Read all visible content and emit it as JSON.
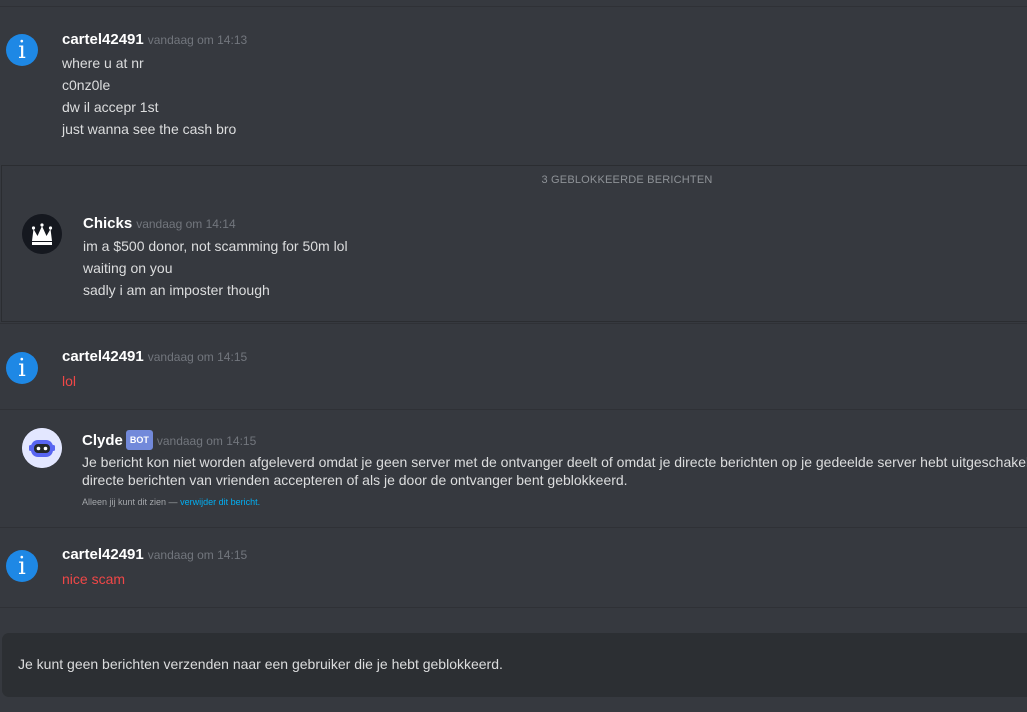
{
  "messages": [
    {
      "username": "cartel42491",
      "timestamp": "vandaag om 14:13",
      "avatar_icon": "info-icon",
      "lines": [
        "where u at nr",
        "c0nz0le",
        "dw il accepr 1st",
        "just wanna see the cash bro"
      ]
    },
    {
      "username": "cartel42491",
      "timestamp": "vandaag om 14:15",
      "avatar_icon": "info-icon",
      "lines": [
        "lol"
      ]
    },
    {
      "username": "cartel42491",
      "timestamp": "vandaag om 14:15",
      "avatar_icon": "info-icon",
      "lines": [
        "nice scam"
      ]
    }
  ],
  "blocked": {
    "label": "3 GEBLOKKEERDE BERICHTEN",
    "username": "Chicks",
    "timestamp": "vandaag om 14:14",
    "avatar_icon": "crown-icon",
    "lines": [
      "im a $500 donor, not scamming for 50m lol",
      "waiting on you",
      "sadly i am an imposter though"
    ]
  },
  "bot": {
    "username": "Clyde",
    "badge": "BOT",
    "timestamp": "vandaag om 14:15",
    "avatar_icon": "robot-icon",
    "lines": [
      "Je bericht kon niet worden afgeleverd omdat je geen server met de ontvanger deelt of omdat je directe berichten op je gedeelde server hebt uitgeschakeld, de ontvanger alleen",
      "directe berichten van vrienden accepteren of als je door de ontvanger bent geblokkeerd."
    ],
    "ephemeral_note": "Alleen jij kunt dit zien —",
    "delete_link": "verwijder dit bericht."
  },
  "composer": {
    "text": "Je kunt geen berichten verzenden naar een gebruiker die je hebt geblokkeerd."
  },
  "colors": {
    "background": "#36393f",
    "username": "#ffffff",
    "timestamp": "#72767d",
    "red_text": "#f04747",
    "bot_badge": "#7289da",
    "link": "#00b0f4",
    "info_avatar": "#1e88e5"
  }
}
